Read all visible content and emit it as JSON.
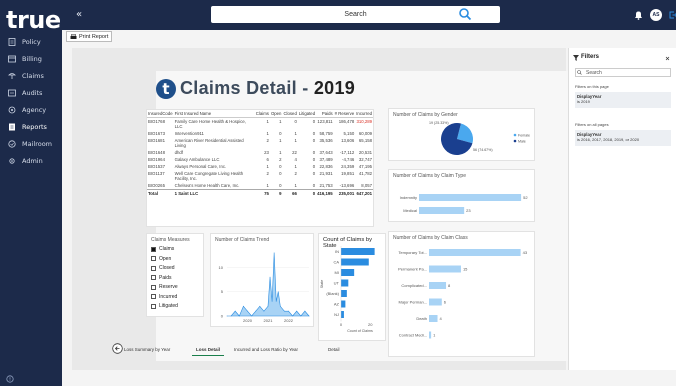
{
  "brand": {
    "logo_text": "true",
    "logo_dot": "."
  },
  "sidebar": {
    "items": [
      {
        "label": "Policy",
        "icon": "document-icon"
      },
      {
        "label": "Billing",
        "icon": "billing-icon"
      },
      {
        "label": "Claims",
        "icon": "claims-icon"
      },
      {
        "label": "Audits",
        "icon": "audits-icon"
      },
      {
        "label": "Agency",
        "icon": "agency-icon"
      },
      {
        "label": "Reports",
        "icon": "reports-icon",
        "active": true
      },
      {
        "label": "Mailroom",
        "icon": "mail-icon"
      },
      {
        "label": "Admin",
        "icon": "admin-icon"
      }
    ]
  },
  "topbar": {
    "collapse_glyph": "«",
    "search_placeholder": "Search",
    "avatar_initials": "AS"
  },
  "toolbar": {
    "print_label": "Print Report"
  },
  "report": {
    "title_letter": "t",
    "title": "Claims Detail",
    "title_sep": " - ",
    "title_year": "2019",
    "table": {
      "headers": [
        "InsuredCode",
        "First Insured Name",
        "Claims",
        "Open",
        "Closed",
        "Litigated",
        "Paids",
        "# Reserve",
        "Incurred"
      ],
      "rows": [
        [
          "BIO1768",
          "Family Care Home Health & Hospice, LLC",
          "1",
          "1",
          "0",
          "0",
          "123,811",
          "186,478",
          "310,289"
        ],
        [
          "BIO1673",
          "Intervention911",
          "1",
          "0",
          "1",
          "0",
          "58,759",
          "5,150",
          "60,009"
        ],
        [
          "BIO1681",
          "American River Residential Assisted Living",
          "2",
          "1",
          "1",
          "0",
          "35,536",
          "13,606",
          "65,158"
        ],
        [
          "BIO1648",
          "dhdf",
          "23",
          "1",
          "22",
          "0",
          "37,643",
          "-17,112",
          "20,531"
        ],
        [
          "BIO1964",
          "Galaxy Ambulance LLC",
          "6",
          "2",
          "4",
          "0",
          "37,489",
          "-4,746",
          "32,747"
        ],
        [
          "BIO1537",
          "Always Personal Care, Inc.",
          "1",
          "0",
          "1",
          "0",
          "22,836",
          "24,359",
          "47,195"
        ],
        [
          "BIO1137",
          "Well Care Congregate Living Health Facility, Inc.",
          "2",
          "0",
          "2",
          "0",
          "21,931",
          "19,851",
          "41,782"
        ],
        [
          "BIO0265",
          "Chelsea's Home Health Care, Inc.",
          "1",
          "0",
          "1",
          "0",
          "21,753",
          "-13,696",
          "8,057"
        ]
      ],
      "total": [
        "Total",
        "1 Saint LLC",
        "75",
        "9",
        "66",
        "0",
        "416,195",
        "235,001",
        "647,201"
      ]
    },
    "measures": {
      "title": "Claims Measures",
      "items": [
        {
          "label": "Claims",
          "checked": true
        },
        {
          "label": "Open",
          "checked": false
        },
        {
          "label": "Closed",
          "checked": false
        },
        {
          "label": "Paids",
          "checked": false
        },
        {
          "label": "Reserve",
          "checked": false
        },
        {
          "label": "Incurred",
          "checked": false
        },
        {
          "label": "Litigated",
          "checked": false
        }
      ]
    },
    "trend": {
      "title": "Number of Claims Trend"
    },
    "state": {
      "title": "Count of Claims by State"
    },
    "gender": {
      "title": "Number of Claims by Gender"
    },
    "claimtype": {
      "title": "Number of Claims by Claim Type"
    },
    "claimclass": {
      "title": "Number of Claims by Claim Class"
    }
  },
  "chart_data": [
    {
      "type": "area",
      "title": "Number of Claims Trend",
      "x": [
        2019.0,
        2019.2,
        2019.4,
        2019.6,
        2019.8,
        2020.0,
        2020.2,
        2020.4,
        2020.6,
        2020.8,
        2021.0,
        2021.1,
        2021.2,
        2021.3,
        2021.4,
        2021.5,
        2021.6,
        2021.8,
        2022.0,
        2022.2,
        2022.4,
        2022.6,
        2022.8,
        2023.0
      ],
      "values": [
        0,
        0,
        1,
        0,
        2,
        1,
        0,
        1,
        2,
        1,
        2,
        8,
        3,
        13,
        3,
        5,
        2,
        1,
        1,
        0,
        1,
        0,
        1,
        0
      ],
      "xticks": [
        "2020",
        "2021",
        "2022"
      ],
      "yticks": [
        "0",
        "5",
        "10"
      ],
      "ylim": [
        0,
        14
      ]
    },
    {
      "type": "bar",
      "title": "Count of Claims by State",
      "ylabel": "State",
      "xlabel": "Count of Claims",
      "categories": [
        "IN",
        "CA",
        "MI",
        "UT",
        "(Blank)",
        "AZ",
        "NJ"
      ],
      "values": [
        23,
        19,
        9,
        5,
        4,
        3,
        2
      ],
      "xticks": [
        "0",
        "20"
      ],
      "xlim": [
        0,
        26
      ]
    },
    {
      "type": "pie",
      "title": "Number of Claims by Gender",
      "categories": [
        "Female",
        "Male"
      ],
      "values": [
        25.3,
        74.7
      ],
      "labels": [
        "19 (25.33%)",
        "56 (74.67%)"
      ],
      "colors": [
        "#4aa8ee",
        "#1a3f8f"
      ]
    },
    {
      "type": "bar",
      "title": "Number of Claims by Claim Type",
      "categories": [
        "Indemnity",
        "Medical"
      ],
      "values": [
        52,
        23
      ],
      "xlim": [
        0,
        55
      ]
    },
    {
      "type": "bar",
      "title": "Number of Claims by Claim Class",
      "categories": [
        "Temporary Tot...",
        "Permanent Pa...",
        "Complicated...",
        "Major Perman...",
        "Death",
        "Contract Medi..."
      ],
      "values": [
        43,
        15,
        8,
        6,
        4,
        1
      ],
      "xlim": [
        0,
        46
      ]
    }
  ],
  "filters": {
    "title": "Filters",
    "search_placeholder": "Search",
    "on_page_label": "Filters on this page",
    "page_filter_name": "DisplayYear",
    "page_filter_value": "is 2019",
    "all_pages_label": "Filters on all pages",
    "all_filter_name": "DisplayYear",
    "all_filter_value": "is 2016, 2017, 2018, 2019, or 2020"
  },
  "tabs": [
    {
      "label": "Loss Summary by Year",
      "active": false
    },
    {
      "label": "Loss Detail",
      "active": true
    },
    {
      "label": "Incurred and Loss Ratio by Year",
      "active": false
    },
    {
      "label": "Detail",
      "active": false
    }
  ],
  "colors": {
    "accent": "#2a8ce0",
    "sidebar": "#1c2a4a",
    "negative": "#d93025"
  }
}
